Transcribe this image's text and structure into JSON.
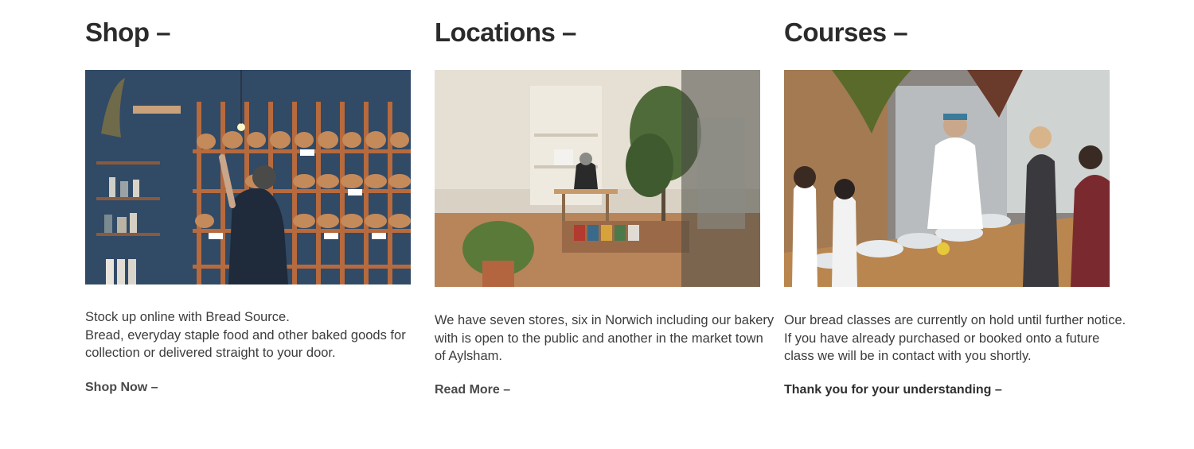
{
  "sections": [
    {
      "heading": "Shop –",
      "image_alt": "Bakery shop wall with loaves on wooden racks",
      "desc_lines": [
        "Stock up online with Bread Source.",
        "Bread, everyday staple food and other baked goods for",
        "collection  or delivered straight to your door."
      ],
      "cta": "Shop Now –"
    },
    {
      "heading": "Locations –",
      "image_alt": "Bakery cafe interior with plants and a seated customer",
      "desc_lines": [
        "We have seven stores, six in Norwich including our bakery",
        "with is open to the public and another in the market town",
        "of Aylsham."
      ],
      "cta": "Read More –"
    },
    {
      "heading": "Courses –",
      "image_alt": "Baker teaching a bread class to students in aprons",
      "desc_lines": [
        "Our bread classes are currently on hold until further notice.",
        "If you have already purchased or booked onto a future",
        "class we will be in contact with you shortly."
      ],
      "cta": "Thank you for your understanding –"
    }
  ]
}
